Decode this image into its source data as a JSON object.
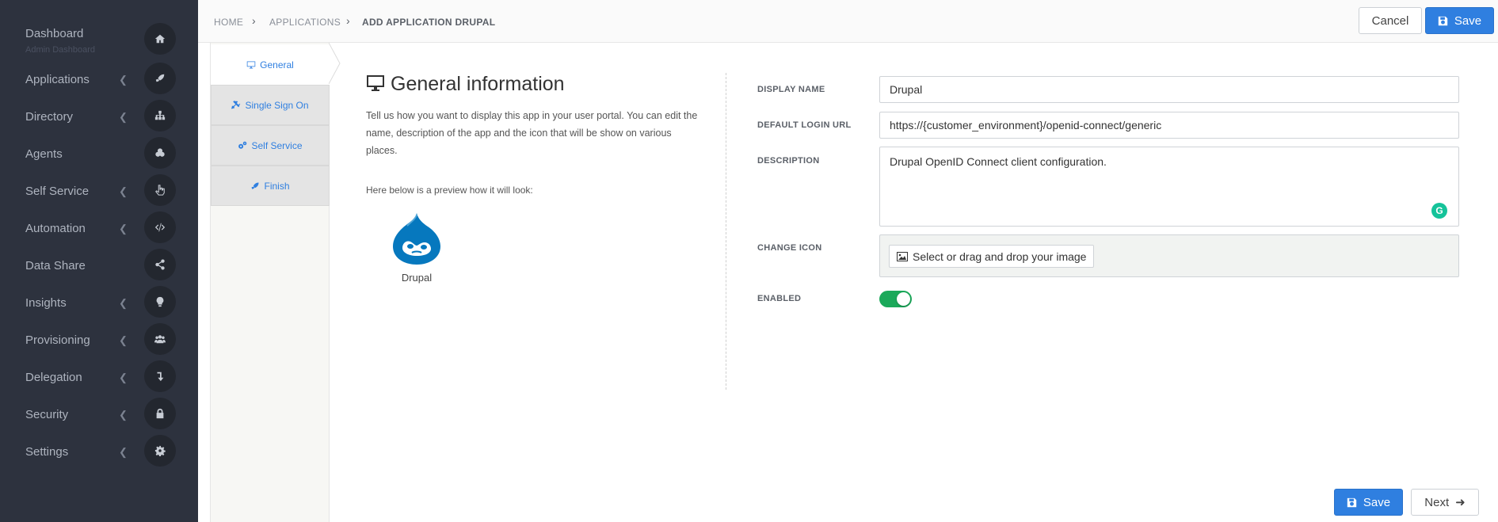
{
  "sidebar": {
    "items": [
      {
        "label": "Dashboard",
        "sublabel": "Admin Dashboard",
        "icon": "home-icon",
        "has_chevron": false
      },
      {
        "label": "Applications",
        "icon": "rocket-icon",
        "has_chevron": true
      },
      {
        "label": "Directory",
        "icon": "sitemap-icon",
        "has_chevron": true
      },
      {
        "label": "Agents",
        "icon": "cogs-icon",
        "has_chevron": false
      },
      {
        "label": "Self Service",
        "icon": "hand-pointer-icon",
        "has_chevron": true
      },
      {
        "label": "Automation",
        "icon": "code-icon",
        "has_chevron": true
      },
      {
        "label": "Data Share",
        "icon": "share-icon",
        "has_chevron": false
      },
      {
        "label": "Insights",
        "icon": "lightbulb-icon",
        "has_chevron": true
      },
      {
        "label": "Provisioning",
        "icon": "users-icon",
        "has_chevron": true
      },
      {
        "label": "Delegation",
        "icon": "level-down-icon",
        "has_chevron": true
      },
      {
        "label": "Security",
        "icon": "lock-icon",
        "has_chevron": true
      },
      {
        "label": "Settings",
        "icon": "gear-icon",
        "has_chevron": true
      }
    ]
  },
  "breadcrumb": {
    "items": [
      "HOME",
      "APPLICATIONS",
      "ADD APPLICATION DRUPAL"
    ]
  },
  "header": {
    "cancel_label": "Cancel",
    "save_label": "Save"
  },
  "wizard": {
    "steps": [
      {
        "label": "General",
        "icon": "desktop-icon"
      },
      {
        "label": "Single Sign On",
        "icon": "plug-icon"
      },
      {
        "label": "Self Service",
        "icon": "cogs-icon"
      },
      {
        "label": "Finish",
        "icon": "rocket-icon"
      }
    ]
  },
  "general": {
    "title": "General information",
    "intro": "Tell us how you want to display this app in your user portal. You can edit the name, description of the app and the icon that will be show on various places.",
    "preview_note": "Here below is a preview how it will look:",
    "app_name": "Drupal"
  },
  "form": {
    "display_name_label": "DISPLAY NAME",
    "display_name_value": "Drupal",
    "login_url_label": "DEFAULT LOGIN URL",
    "login_url_value": "https://{customer_environment}/openid-connect/generic",
    "description_label": "DESCRIPTION",
    "description_value": "Drupal OpenID Connect client configuration.",
    "change_icon_label": "CHANGE ICON",
    "change_icon_button": "Select or drag and drop your image",
    "enabled_label": "ENABLED",
    "enabled": true
  },
  "footer": {
    "save_label": "Save",
    "next_label": "Next"
  },
  "colors": {
    "sidebar_bg": "#2d323e",
    "primary": "#2f7fe0",
    "toggle_on": "#1ba95a",
    "drupal_blue": "#0678be"
  }
}
